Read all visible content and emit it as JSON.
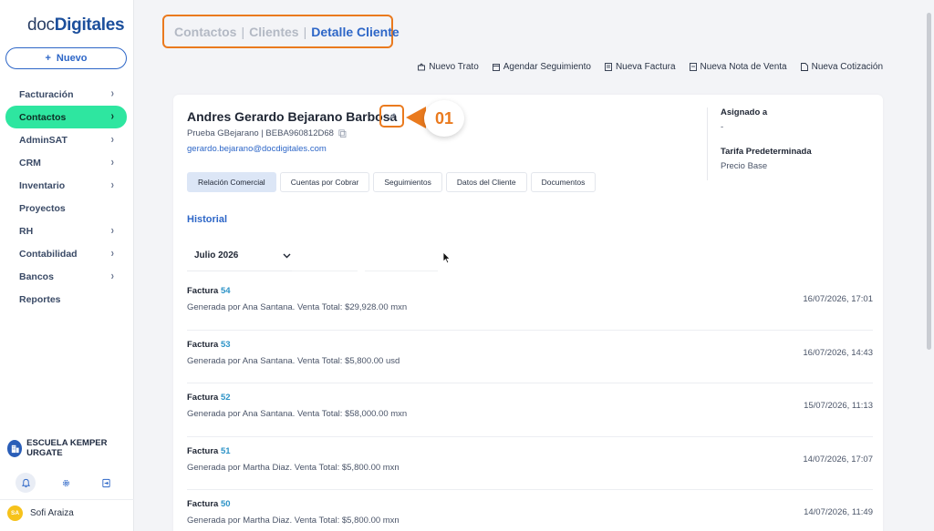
{
  "brand": {
    "logo_light": "doc",
    "logo_bold": "Digitales"
  },
  "sidebar": {
    "new_button": "Nuevo",
    "items": [
      {
        "label": "Facturación",
        "chevron": true
      },
      {
        "label": "Contactos",
        "chevron": true,
        "active": true
      },
      {
        "label": "AdminSAT",
        "chevron": true
      },
      {
        "label": "CRM",
        "chevron": true
      },
      {
        "label": "Inventario",
        "chevron": true
      },
      {
        "label": "Proyectos",
        "chevron": false
      },
      {
        "label": "RH",
        "chevron": true
      },
      {
        "label": "Contabilidad",
        "chevron": true
      },
      {
        "label": "Bancos",
        "chevron": true
      },
      {
        "label": "Reportes",
        "chevron": false
      }
    ],
    "company": "ESCUELA KEMPER URGATE",
    "user": {
      "initials": "SA",
      "name": "Sofi Araiza"
    }
  },
  "breadcrumb": {
    "item1": "Contactos",
    "item2": "Clientes",
    "item3": "Detalle Cliente",
    "separator": "|"
  },
  "actions": [
    "Nuevo Trato",
    "Agendar Seguimiento",
    "Nueva Factura",
    "Nueva Nota de Venta",
    "Nueva Cotización"
  ],
  "client": {
    "name": "Andres Gerardo Bejarano Barbosa",
    "subtitle": "Prueba GBejarano | BEBA960812D68",
    "email": "gerardo.bejarano@docdigitales.com",
    "callout": "01",
    "assigned_label": "Asignado a",
    "assigned_value": "-",
    "rate_label": "Tarifa Predeterminada",
    "rate_value": "Precio Base"
  },
  "tabs": [
    "Relación Comercial",
    "Cuentas por Cobrar",
    "Seguimientos",
    "Datos del Cliente",
    "Documentos"
  ],
  "history": {
    "title": "Historial",
    "month": "Julio 2026",
    "events": [
      {
        "type": "Factura",
        "number": "54",
        "description": "Generada por Ana Santana. Venta Total: $29,928.00 mxn",
        "date": "16/07/2026, 17:01"
      },
      {
        "type": "Factura",
        "number": "53",
        "description": "Generada por Ana Santana. Venta Total: $5,800.00 usd",
        "date": "16/07/2026, 14:43"
      },
      {
        "type": "Factura",
        "number": "52",
        "description": "Generada por Ana Santana. Venta Total: $58,000.00 mxn",
        "date": "15/07/2026, 11:13"
      },
      {
        "type": "Factura",
        "number": "51",
        "description": "Generada por Martha Diaz. Venta Total: $5,800.00 mxn",
        "date": "14/07/2026, 17:07"
      },
      {
        "type": "Factura",
        "number": "50",
        "description": "Generada por Martha Diaz. Venta Total: $5,800.00 mxn",
        "date": "14/07/2026, 11:49"
      }
    ]
  },
  "colors": {
    "primary": "#2d66c7",
    "active_nav": "#2ee6a0",
    "highlight": "#ea7a1e",
    "link_number": "#2d93c7"
  }
}
